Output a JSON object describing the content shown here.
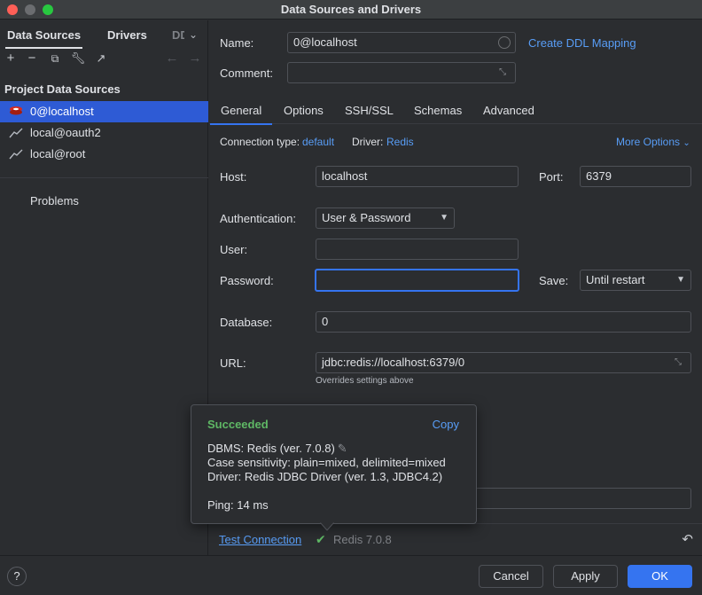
{
  "window": {
    "title": "Data Sources and Drivers"
  },
  "left": {
    "tabs": [
      "Data Sources",
      "Drivers",
      "DD"
    ],
    "section_title": "Project Data Sources",
    "items": [
      "0@localhost",
      "local@oauth2",
      "local@root"
    ],
    "problems": "Problems"
  },
  "form": {
    "name_label": "Name:",
    "name_value": "0@localhost",
    "ddl_link": "Create DDL Mapping",
    "comment_label": "Comment:",
    "tabs": [
      "General",
      "Options",
      "SSH/SSL",
      "Schemas",
      "Advanced"
    ],
    "conn_type_label": "Connection type:",
    "conn_type_value": "default",
    "driver_label": "Driver:",
    "driver_value": "Redis",
    "more_options": "More Options",
    "host_label": "Host:",
    "host_value": "localhost",
    "port_label": "Port:",
    "port_value": "6379",
    "auth_label": "Authentication:",
    "auth_value": "User & Password",
    "user_label": "User:",
    "user_value": "",
    "password_label": "Password:",
    "password_value": "",
    "save_label": "Save:",
    "save_value": "Until restart",
    "database_label": "Database:",
    "database_value": "0",
    "url_label": "URL:",
    "url_value": "jdbc:redis://localhost:6379/0",
    "url_hint": "Overrides settings above"
  },
  "popup": {
    "status": "Succeeded",
    "copy": "Copy",
    "dbms": "DBMS: Redis (ver. 7.0.8)",
    "case": "Case sensitivity: plain=mixed, delimited=mixed",
    "driver": "Driver: Redis JDBC Driver (ver. 1.3, JDBC4.2)",
    "ping": "Ping: 14 ms"
  },
  "bottom": {
    "test_connection": "Test Connection",
    "version": "Redis 7.0.8"
  },
  "footer": {
    "help": "?",
    "cancel": "Cancel",
    "apply": "Apply",
    "ok": "OK"
  },
  "colors": {
    "accent": "#3574f0",
    "selection": "#2e5bd5",
    "success": "#5fb865",
    "link": "#589df6"
  }
}
